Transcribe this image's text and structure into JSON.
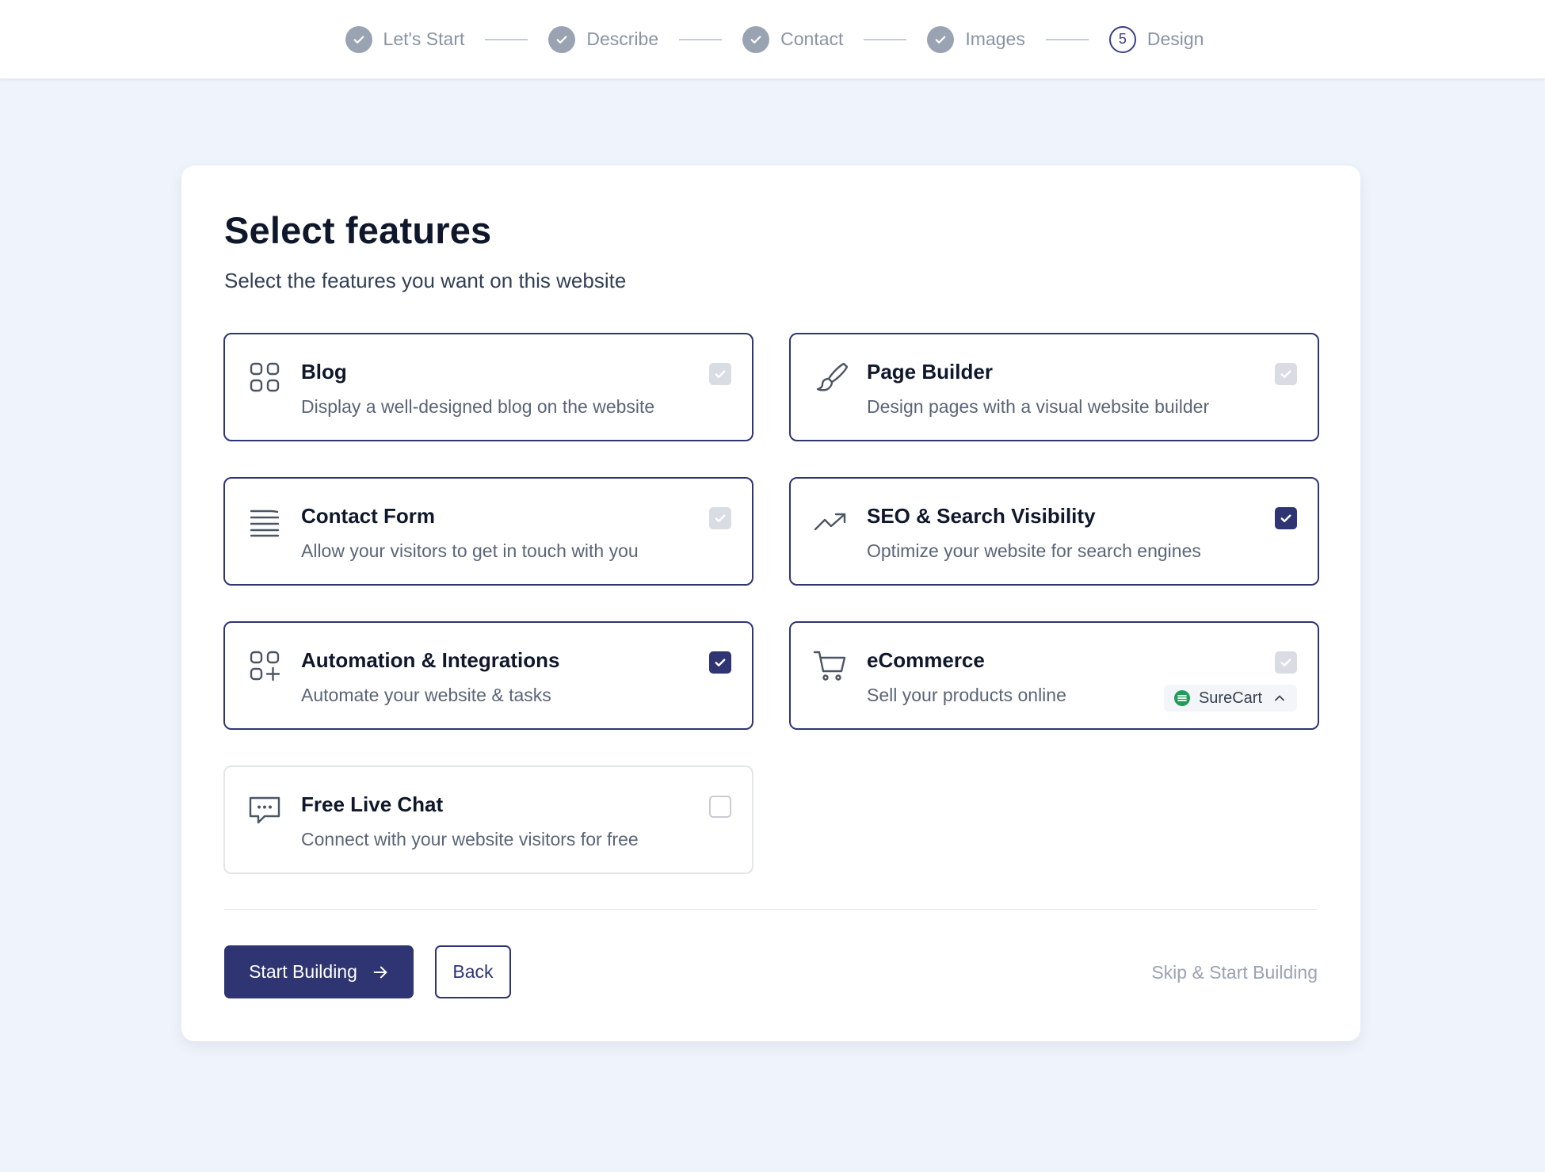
{
  "stepper": {
    "steps": [
      {
        "label": "Let's Start",
        "state": "done"
      },
      {
        "label": "Describe",
        "state": "done"
      },
      {
        "label": "Contact",
        "state": "done"
      },
      {
        "label": "Images",
        "state": "done"
      },
      {
        "label": "Design",
        "state": "current",
        "number": "5"
      }
    ]
  },
  "main": {
    "title": "Select features",
    "subtitle": "Select the features you want on this website"
  },
  "features": [
    {
      "title": "Blog",
      "description": "Display a well-designed blog on the website",
      "icon": "blocks-icon",
      "state": "locked"
    },
    {
      "title": "Page Builder",
      "description": "Design pages with a visual website builder",
      "icon": "brush-icon",
      "state": "locked"
    },
    {
      "title": "Contact Form",
      "description": "Allow your visitors to get in touch with you",
      "icon": "form-lines-icon",
      "state": "locked"
    },
    {
      "title": "SEO & Search Visibility",
      "description": "Optimize your website for search engines",
      "icon": "trending-up-icon",
      "state": "checked"
    },
    {
      "title": "Automation & Integrations",
      "description": "Automate your website & tasks",
      "icon": "squares-plus-icon",
      "state": "checked"
    },
    {
      "title": "eCommerce",
      "description": "Sell your products online",
      "icon": "cart-icon",
      "state": "locked",
      "plugin": "SureCart"
    },
    {
      "title": "Free Live Chat",
      "description": "Connect with your website visitors for free",
      "icon": "chat-bubble-icon",
      "state": "unchecked"
    }
  ],
  "actions": {
    "start_label": "Start Building",
    "back_label": "Back",
    "skip_label": "Skip & Start Building"
  },
  "colors": {
    "accent": "#2f3573",
    "background": "#eff3fb",
    "locked_checkbox": "#d9dce2",
    "plugin_green": "#1f9d5a"
  }
}
